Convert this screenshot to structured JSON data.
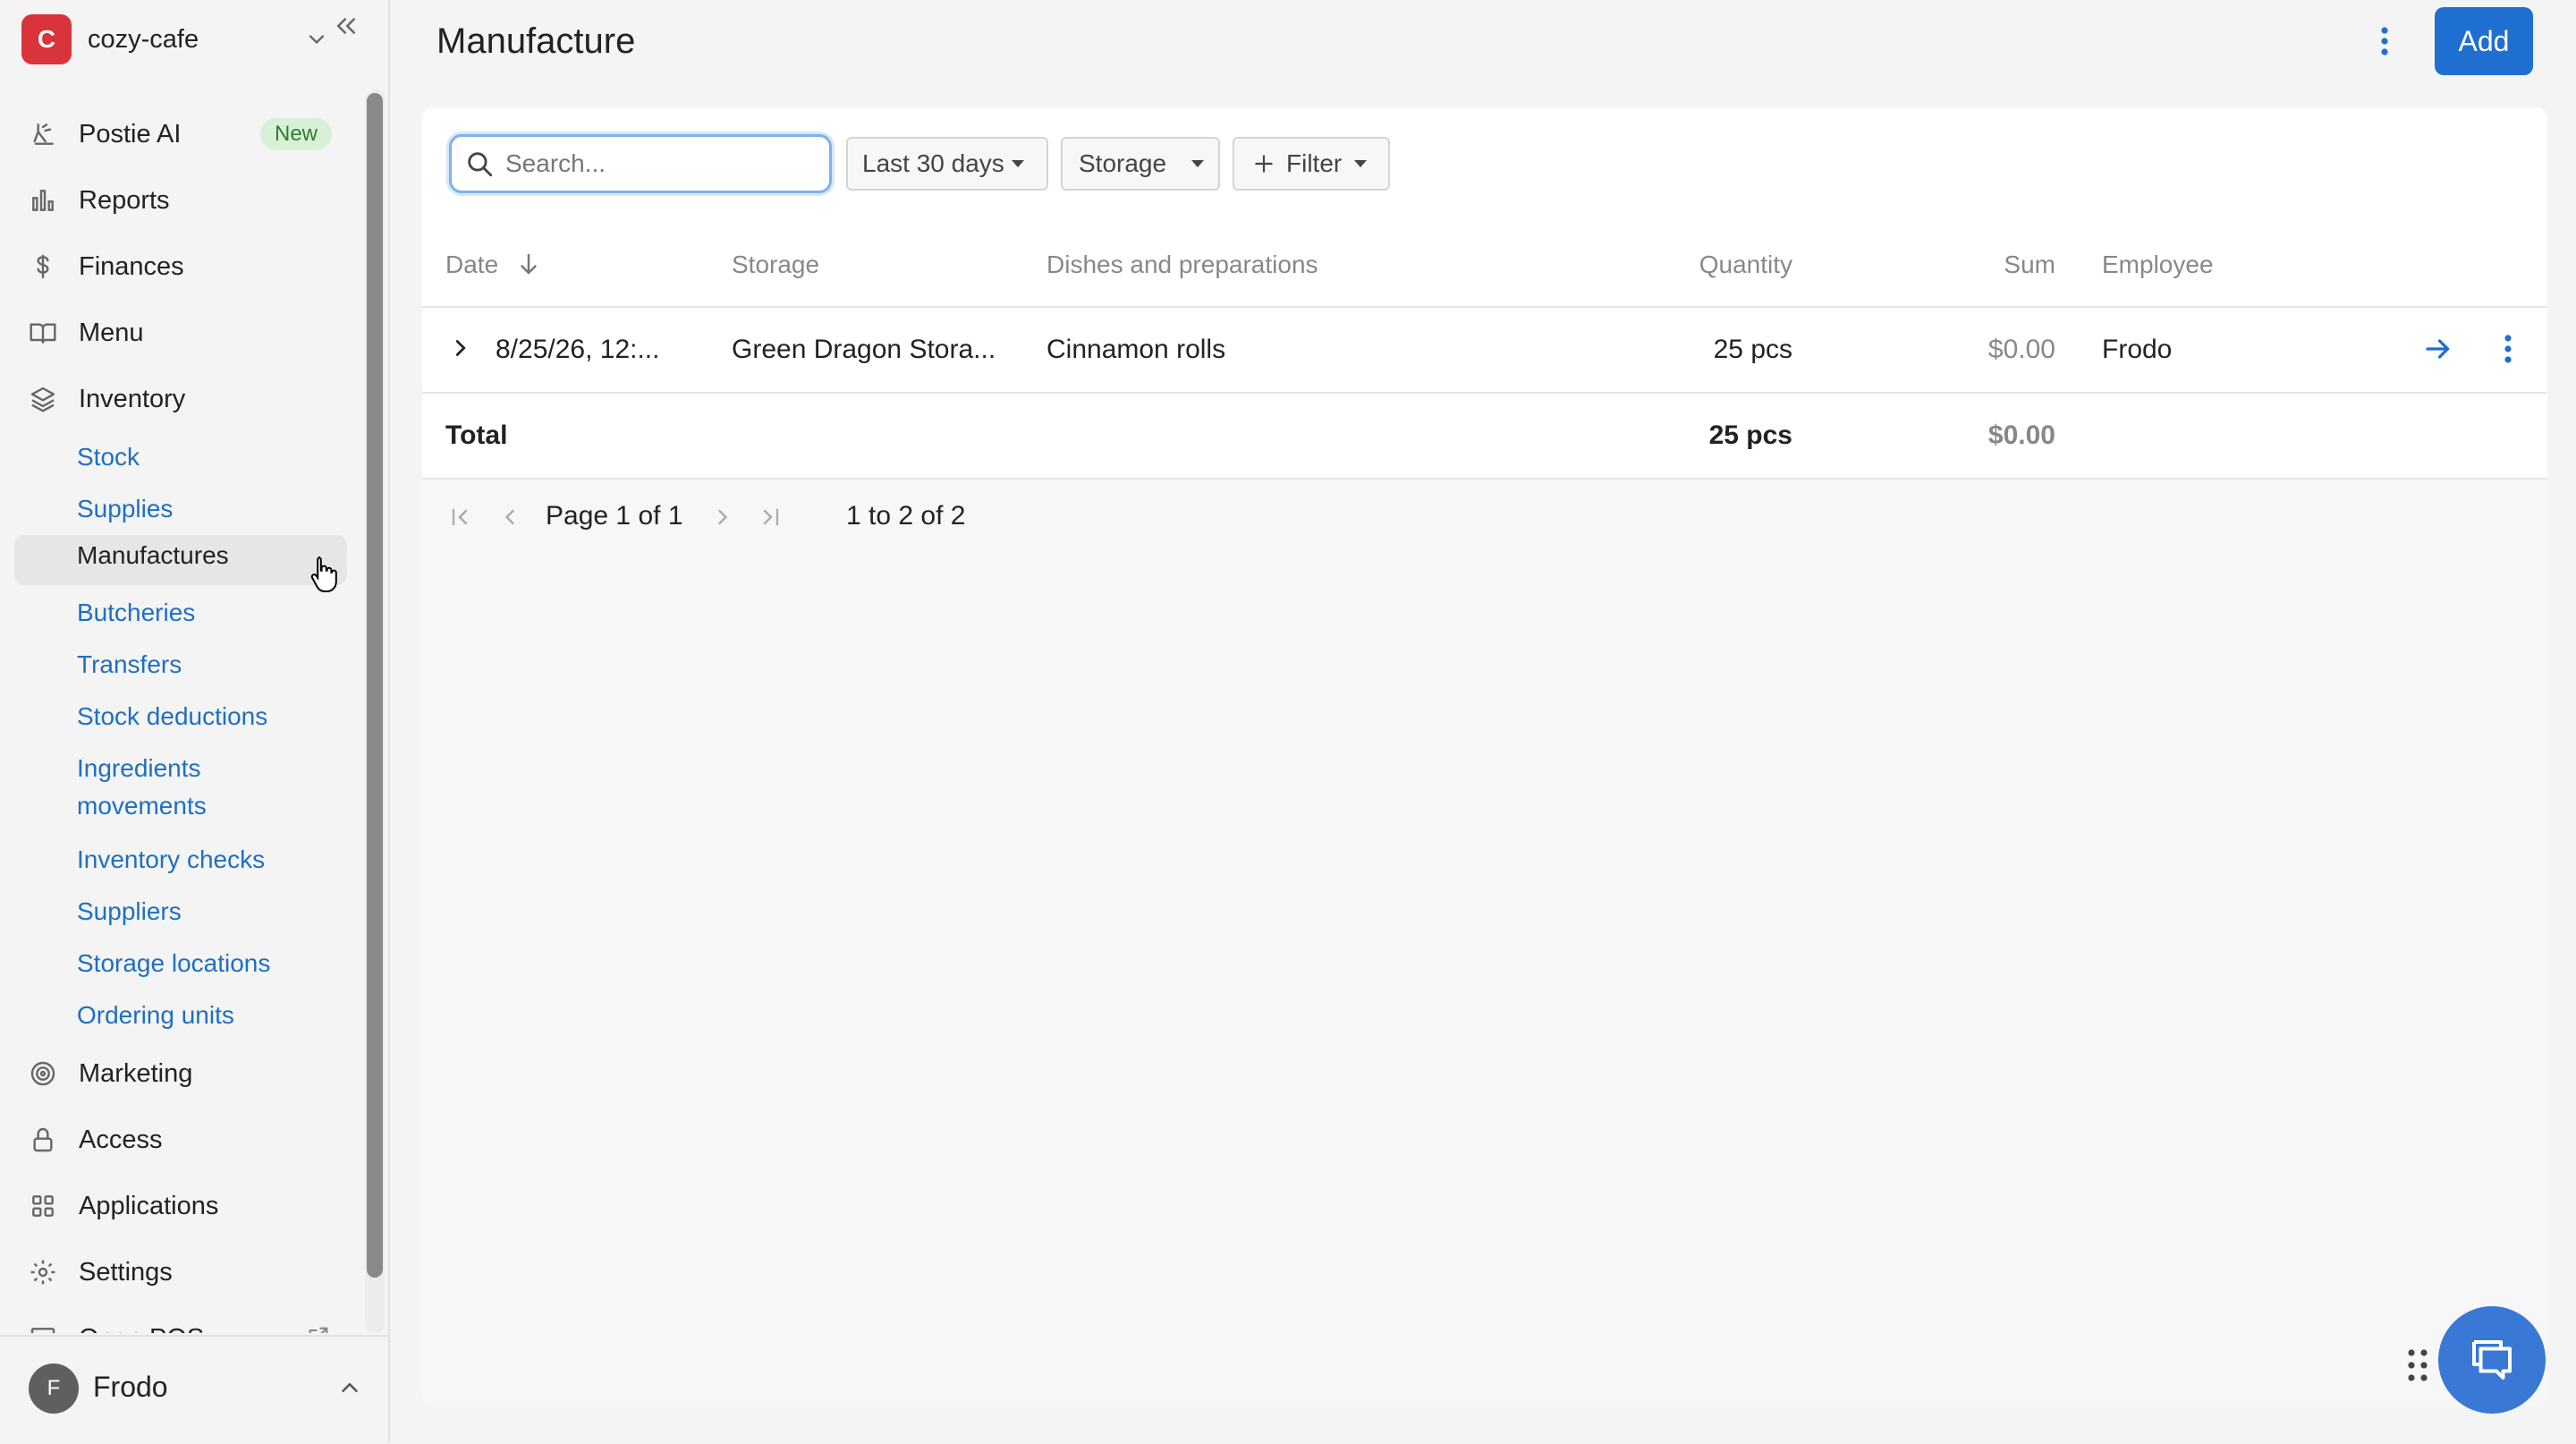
{
  "workspace": {
    "initial": "C",
    "name": "cozy-cafe"
  },
  "nav": {
    "items": [
      {
        "label": "Postie AI",
        "icon": "ai-icon",
        "badge": "New"
      },
      {
        "label": "Reports",
        "icon": "bar-chart-icon"
      },
      {
        "label": "Finances",
        "icon": "dollar-icon"
      },
      {
        "label": "Menu",
        "icon": "book-icon"
      },
      {
        "label": "Inventory",
        "icon": "layers-icon"
      }
    ],
    "inventory_sub": [
      "Stock",
      "Supplies",
      "Manufactures",
      "Butcheries",
      "Transfers",
      "Stock deductions",
      "Ingredients",
      "movements",
      "Inventory checks",
      "Suppliers",
      "Storage locations",
      "Ordering units"
    ],
    "items_after": [
      {
        "label": "Marketing",
        "icon": "target-icon"
      },
      {
        "label": "Access",
        "icon": "lock-icon"
      },
      {
        "label": "Applications",
        "icon": "grid-icon"
      },
      {
        "label": "Settings",
        "icon": "gear-icon"
      },
      {
        "label": "Open POS",
        "icon": "monitor-icon"
      }
    ]
  },
  "user": {
    "initial": "F",
    "name": "Frodo"
  },
  "header": {
    "title": "Manufacture",
    "add_label": "Add"
  },
  "filters": {
    "search_placeholder": "Search...",
    "period": "Last 30 days",
    "storage": "Storage",
    "filter": "Filter"
  },
  "table": {
    "columns": [
      "Date",
      "Storage",
      "Dishes and preparations",
      "Quantity",
      "Sum",
      "Employee"
    ],
    "rows": [
      {
        "date": "8/25/26, 12:...",
        "storage": "Green Dragon Stora...",
        "dishes": "Cinnamon rolls",
        "quantity": "25 pcs",
        "sum": "$0.00",
        "employee": "Frodo"
      }
    ],
    "total": {
      "label": "Total",
      "quantity": "25 pcs",
      "sum": "$0.00"
    }
  },
  "pagination": {
    "page_word": "Page",
    "current": "1",
    "of_word": "of",
    "total_pages": "1",
    "range": "1 to 2 of 2"
  },
  "colors": {
    "accent": "#1f6fd0",
    "link": "#1f6fc0",
    "brand": "#d9343b"
  }
}
